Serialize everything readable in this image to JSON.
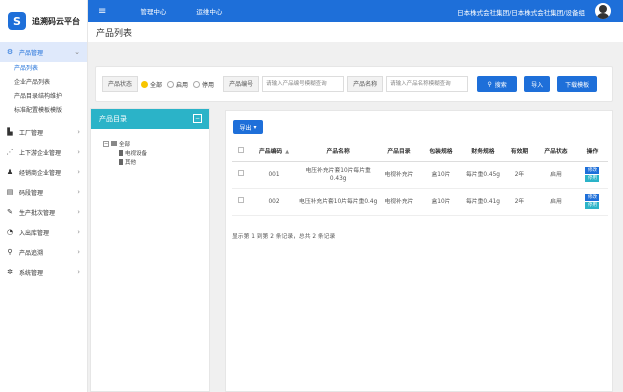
{
  "app": {
    "logo_mark": "S",
    "name": "追溯码云平台"
  },
  "topbar": {
    "menu_icon": "menu-icon",
    "tabs": [
      "管理中心",
      "运维中心"
    ],
    "company": "日本株式会社集团/日本株式会社集团/设备组",
    "colors": {
      "primary": "#1e6fd9",
      "teal": "#2bb3c8"
    }
  },
  "page": {
    "title": "产品列表"
  },
  "sidebar": {
    "items": [
      {
        "label": "产品管理",
        "icon": "gear-icon",
        "active": true,
        "subs": [
          "产品列表",
          "企业产品列表",
          "产品目录结构维护",
          "标准配置模板模版"
        ]
      },
      {
        "label": "工厂管理",
        "icon": "factory-icon"
      },
      {
        "label": "上下游企业管理",
        "icon": "share-icon"
      },
      {
        "label": "经销商企业管理",
        "icon": "users-icon"
      },
      {
        "label": "码段管理",
        "icon": "code-icon"
      },
      {
        "label": "生产批次管理",
        "icon": "pen-icon"
      },
      {
        "label": "入出库管理",
        "icon": "box-icon"
      },
      {
        "label": "产品追溯",
        "icon": "search-icon"
      },
      {
        "label": "系统管理",
        "icon": "settings-icon"
      }
    ]
  },
  "filter": {
    "status_label": "产品状态",
    "radios": [
      "全部",
      "启用",
      "停用"
    ],
    "code_label": "产品编号",
    "code_placeholder": "请输入产品编号模糊查询",
    "name_label": "产品名称",
    "name_placeholder": "请输入产品名称模糊查询",
    "search_btn": "搜索",
    "import_btn": "导入",
    "download_btn": "下载模板"
  },
  "tree": {
    "title": "产品目录",
    "root": "全部",
    "children": [
      "电视设备",
      "其他"
    ]
  },
  "table": {
    "export_btn": "导出",
    "columns": [
      "产品编码",
      "产品名称",
      "产品目录",
      "包装规格",
      "财务规格",
      "有效期",
      "产品状态",
      "操作"
    ],
    "rows": [
      {
        "code": "001",
        "name": "电压补充片套10片每片重0.43g",
        "catalog": "电视补充片",
        "pack": "盒10片",
        "finance": "每片重0.45g",
        "valid": "2年",
        "status": "启用",
        "edit": "修改",
        "stop": "停用"
      },
      {
        "code": "002",
        "name": "电压补充片套10片每片重0.4g",
        "catalog": "电视补充片",
        "pack": "盒10片",
        "finance": "每片重0.41g",
        "valid": "2年",
        "status": "启用",
        "edit": "修改",
        "stop": "停用"
      }
    ],
    "pager": "显示第 1 到第 2 条记录，总共 2 条记录"
  }
}
